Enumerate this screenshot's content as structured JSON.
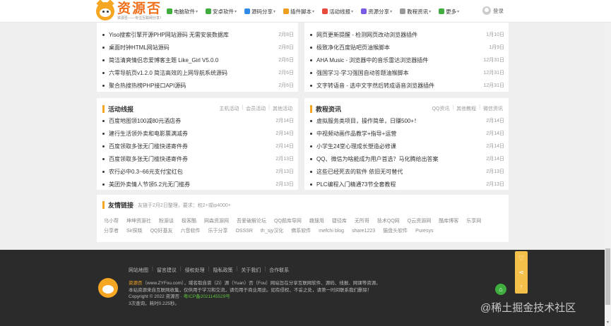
{
  "header": {
    "logo_title": "资源否",
    "logo_sub": "资源否——专注互联网分享！",
    "nav": [
      {
        "label": "电脑软件",
        "icon": "computer-icon",
        "color": "#3fae3f"
      },
      {
        "label": "安卓软件",
        "icon": "android-icon",
        "color": "#3fae3f"
      },
      {
        "label": "源码分享",
        "icon": "code-icon",
        "color": "#2e8ae6"
      },
      {
        "label": "插件脚本",
        "icon": "plugin-icon",
        "color": "#f0a020"
      },
      {
        "label": "活动线报",
        "icon": "event-icon",
        "color": "#e84a3a"
      },
      {
        "label": "资源分享",
        "icon": "share-icon",
        "color": "#7a5ae6"
      },
      {
        "label": "教程资讯",
        "icon": "tutorial-icon",
        "color": "#999999"
      },
      {
        "label": "更多",
        "icon": "more-icon",
        "color": "#3fae3f"
      }
    ],
    "login_label": "登录"
  },
  "top_left": {
    "items": [
      {
        "title": "Yiso搜索引擎开源PHP网站源码 无需安装数据库",
        "date": "2月8日"
      },
      {
        "title": "桌面时钟HTML网站源码",
        "date": "2月8日"
      },
      {
        "title": "简洁清爽情侣恋爱博客主题 Like_Girl V5.0.0",
        "date": "2月6日"
      },
      {
        "title": "六零导航页v1.2.0 简洁高效的上网导航系统源码",
        "date": "2月6日"
      },
      {
        "title": "聚合热搜热榜PHP接口API源码",
        "date": "2月6日"
      }
    ]
  },
  "top_right": {
    "items": [
      {
        "title": "网页更新提醒 - 检测网页改动浏览器插件",
        "date": "1月10日"
      },
      {
        "title": "极致净化百度贴吧页油猴脚本",
        "date": "1月9日"
      },
      {
        "title": "AHA Music - 浏览器中的音乐雷达浏览器插件",
        "date": "12月31日"
      },
      {
        "title": "强国学习-学习强国自动答题油猴脚本",
        "date": "12月31日"
      },
      {
        "title": "文字转语音 - 选中文字然后转成语音浏览器插件",
        "date": "12月31日"
      }
    ]
  },
  "activity": {
    "title": "活动线报",
    "links": [
      "主机活动",
      "会员活动",
      "其他活动"
    ],
    "items": [
      {
        "title": "百度地图领100减80元酒店券",
        "date": "2月14日"
      },
      {
        "title": "建行生活领外卖和电影票满减券",
        "date": "2月14日"
      },
      {
        "title": "百度领取多张无门槛快递寄件券",
        "date": "2月14日"
      },
      {
        "title": "百度领取多张无门槛快递寄件券",
        "date": "2月13日"
      },
      {
        "title": "农行必中0.3~66元支付宝红包",
        "date": "2月13日"
      },
      {
        "title": "美团外卖情人节领5.2元无门槛券",
        "date": "2月13日"
      }
    ]
  },
  "tutorials": {
    "title": "教程资讯",
    "links": [
      "QQ资讯",
      "其他教程",
      "微信资讯"
    ],
    "items": [
      {
        "title": "虚拟服务类项目，操作简单，日赚500+！",
        "date": "2月14日"
      },
      {
        "title": "中视频动画作品教学+指导+运营",
        "date": "2月14日"
      },
      {
        "title": "小学生24堂心理成长塑造必修课",
        "date": "2月14日"
      },
      {
        "title": "QQ、微信为啥能成为用户首选？马化腾给出答案",
        "date": "2月14日"
      },
      {
        "title": "这些已经死去的软件 依旧无可替代",
        "date": "2月13日"
      },
      {
        "title": "PLC编程入门精通73节全套教程",
        "date": "2月13日"
      }
    ]
  },
  "friends": {
    "title": "友情链接",
    "note": "友链于2月2日整理，要求：权2+或ip4000+",
    "links": [
      "乌小帮",
      "坤坤资源社",
      "粉源谈",
      "极客酷",
      "网森资源网",
      "吾爱破解论坛",
      "QQ题库导网",
      "趣搜用",
      "捷径库",
      "无所哥",
      "技术QQ网",
      "Q云资源网",
      "酷库博客",
      "乐享网",
      "分享者",
      "Sir探晓",
      "QQ好基友",
      "六音软件",
      "乐于分享",
      "OSSSR",
      "th_sjy汉化",
      "佛系软件",
      "mefchi blog",
      "share1223",
      "猫盘头软件",
      "Puresys"
    ]
  },
  "footer": {
    "links": [
      "网站地图",
      "留言建议",
      "侵权处理",
      "隐私政策",
      "关于我们",
      "合作联系"
    ],
    "line1_brand": "资源否",
    "line1_rest": "（www.ZYFou.com），域名取自资（Zi）源（Yuan）否（Fou）网站旨在分享互联网软件、源码、线报、网课等资源。",
    "line2": "本站资源来自互联网收集，仅供用于学习和交流，请勿用于商业用途。如有侵权、不妥之处，请第一时间联系我们删除！",
    "line3_prefix": "Copyright © 2022 资源否 · ",
    "icp": "粤ICP备2021145529号",
    "line4": "3次查询，耗时0.225秒。"
  },
  "watermark": "@稀土掘金技术社区"
}
